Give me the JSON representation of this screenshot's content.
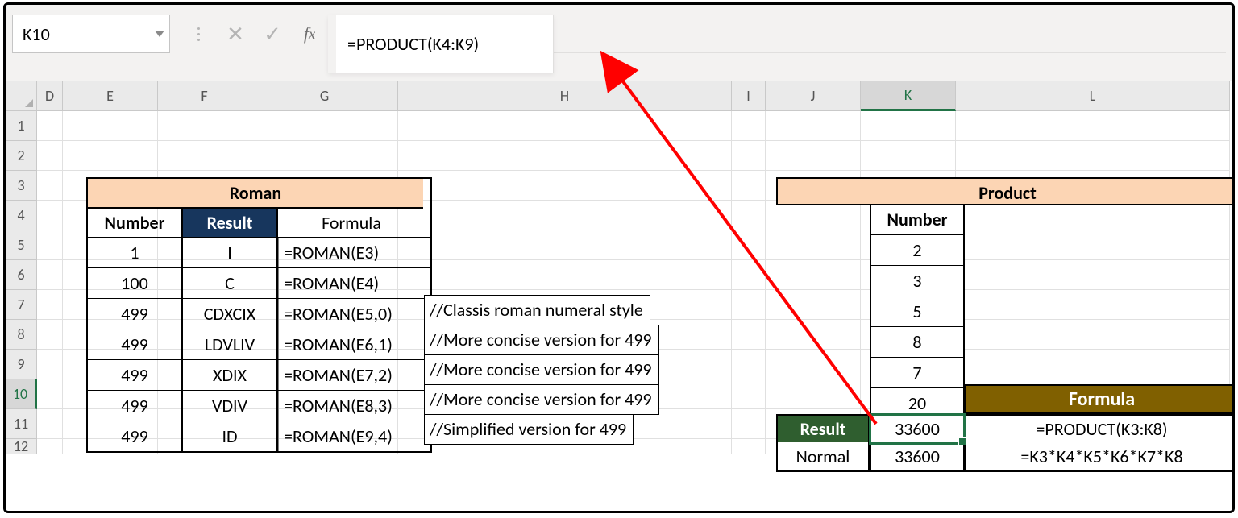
{
  "namebox_value": "K10",
  "formula_bar": "=PRODUCT(K4:K9)",
  "col_headers": [
    "D",
    "E",
    "F",
    "G",
    "H",
    "I",
    "J",
    "K",
    "L"
  ],
  "row_headers": [
    "1",
    "2",
    "3",
    "4",
    "5",
    "6",
    "7",
    "8",
    "9",
    "10",
    "11",
    "12"
  ],
  "active_col": "K",
  "active_row": "10",
  "roman": {
    "title": "Roman",
    "hdr_number": "Number",
    "hdr_result": "Result",
    "hdr_formula": "Formula",
    "rows": [
      {
        "num": "1",
        "res": "I",
        "formula": "=ROMAN(E3)",
        "comment": ""
      },
      {
        "num": "100",
        "res": "C",
        "formula": "=ROMAN(E4)",
        "comment": ""
      },
      {
        "num": "499",
        "res": "CDXCIX",
        "formula": "=ROMAN(E5,0)",
        "comment": "//Classis roman numeral style"
      },
      {
        "num": "499",
        "res": "LDVLIV",
        "formula": "=ROMAN(E6,1)",
        "comment": "//More concise version for 499"
      },
      {
        "num": "499",
        "res": "XDIX",
        "formula": "=ROMAN(E7,2)",
        "comment": "//More concise version for 499"
      },
      {
        "num": "499",
        "res": "VDIV",
        "formula": "=ROMAN(E8,3)",
        "comment": "//More concise version for 499"
      },
      {
        "num": "499",
        "res": "ID",
        "formula": "=ROMAN(E9,4)",
        "comment": "//Simplified version for 499"
      }
    ]
  },
  "product": {
    "title": "Product",
    "hdr_number": "Number",
    "k_values": [
      "2",
      "3",
      "5",
      "8",
      "7",
      "20"
    ],
    "formula_hdr": "Formula",
    "result_lbl": "Result",
    "normal_lbl": "Normal",
    "k10": "33600",
    "k11": "33600",
    "l10": "=PRODUCT(K3:K8)",
    "l11": "=K3*K4*K5*K6*K7*K8"
  }
}
